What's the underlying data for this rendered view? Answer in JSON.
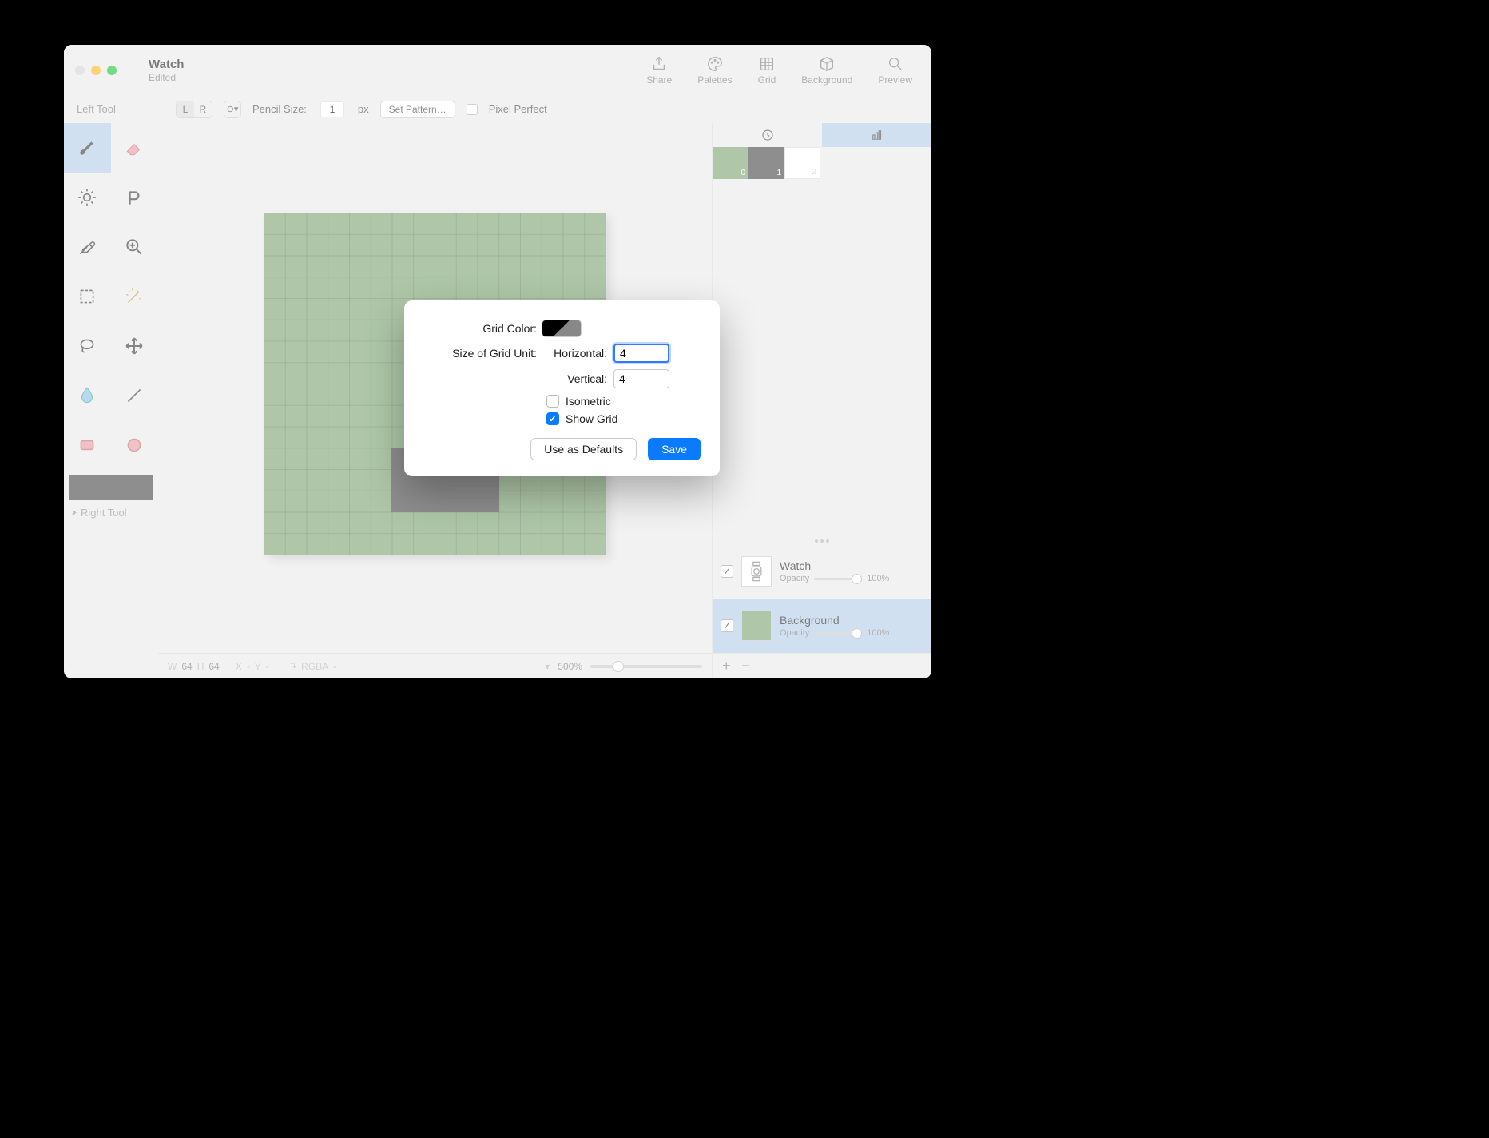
{
  "window": {
    "title": "Watch",
    "subtitle": "Edited"
  },
  "header_tools": {
    "share": "Share",
    "palettes": "Palettes",
    "grid": "Grid",
    "background": "Background",
    "preview": "Preview"
  },
  "optionbar": {
    "left_tool": "Left Tool",
    "lr": {
      "l": "L",
      "r": "R"
    },
    "dropdown_glyph": "⊝▾",
    "pencil_size_label": "Pencil Size:",
    "pencil_size_value": "1",
    "pencil_size_unit": "px",
    "set_pattern": "Set Pattern…",
    "pixel_perfect": "Pixel Perfect"
  },
  "right_tool_label": "Right Tool",
  "swatches": [
    {
      "idx": "0",
      "class": "sw0"
    },
    {
      "idx": "1",
      "class": "sw1"
    },
    {
      "idx": "2",
      "class": "sw2"
    }
  ],
  "layers": [
    {
      "name": "Watch",
      "opacity_label": "Opacity",
      "opacity": "100%",
      "selected": false,
      "thumb": "watch"
    },
    {
      "name": "Background",
      "opacity_label": "Opacity",
      "opacity": "100%",
      "selected": true,
      "thumb": "green"
    }
  ],
  "statusbar": {
    "w_label": "W",
    "w": "64",
    "h_label": "H",
    "h": "64",
    "x_label": "X",
    "x": "-",
    "y_label": "Y",
    "y": "-",
    "mode": "RGBA",
    "mode_val": "-",
    "zoom_glyph": "▾",
    "zoom": "500%"
  },
  "dialog": {
    "grid_color_label": "Grid Color:",
    "size_label": "Size of Grid Unit:",
    "horizontal_label": "Horizontal:",
    "horizontal_value": "4",
    "vertical_label": "Vertical:",
    "vertical_value": "4",
    "isometric_label": "Isometric",
    "isometric_checked": false,
    "show_grid_label": "Show Grid",
    "show_grid_checked": true,
    "use_defaults": "Use as Defaults",
    "save": "Save"
  },
  "right_bottom": {
    "plus": "+",
    "minus": "−"
  }
}
